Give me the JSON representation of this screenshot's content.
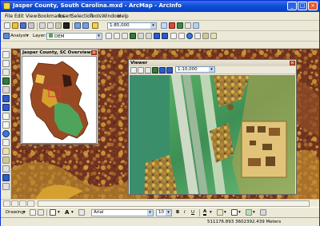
{
  "window": {
    "title": "Jasper County, South Carolina.mxd - ArcMap - ArcInfo",
    "controls": [
      "minimize-icon",
      "maximize-icon",
      "close-icon"
    ]
  },
  "menu": {
    "items": [
      "File",
      "Edit",
      "View",
      "Bookmarks",
      "Insert",
      "Selection",
      "Tools",
      "Window",
      "Help"
    ]
  },
  "toolbar": {
    "scale": "1:85,000"
  },
  "analyst": {
    "analyst_label": "Analyst",
    "layer_label": "Layer:",
    "layer_value": "DEM"
  },
  "overview": {
    "title": "Jasper County, SC Overview"
  },
  "viewer": {
    "title": "Viewer",
    "scale": "1:10,000"
  },
  "drawing": {
    "menu_label": "Drawing",
    "font_name": "Arial",
    "font_size": "10",
    "bold": "B",
    "italic": "I",
    "underline": "U",
    "font_color": "A"
  },
  "status": {
    "coordinates": "511176.893  3602392.439 Meters"
  },
  "colors": {
    "titlebar": "#0d4dd6",
    "chrome": "#ece9d8",
    "map_base": "#7a3c22",
    "dem_green": "#4fa35a",
    "dem_orange": "#d6a031"
  }
}
